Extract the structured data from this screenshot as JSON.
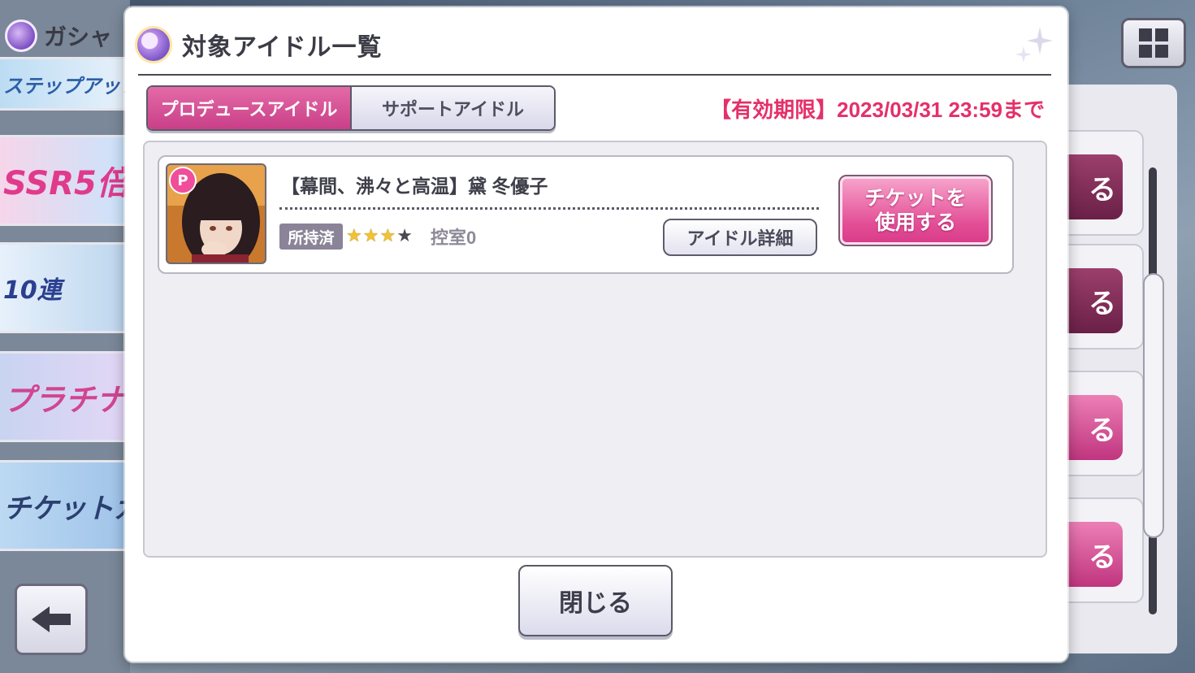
{
  "background": {
    "gacha_title": "ガシャ",
    "banners": [
      {
        "text": "ステップアップガ"
      },
      {
        "text": "SSR5倍"
      },
      {
        "text": "10連"
      },
      {
        "text": "プラチナガ"
      },
      {
        "text": "チケットガ"
      }
    ],
    "right_buttons": [
      "る",
      "る",
      "る",
      "る"
    ]
  },
  "modal": {
    "title": "対象アイドル一覧",
    "tabs": [
      {
        "label": "プロデュースアイドル",
        "active": true
      },
      {
        "label": "サポートアイドル",
        "active": false
      }
    ],
    "expiry_text": "【有効期限】2023/03/31 23:59まで",
    "idols": [
      {
        "name": "【幕間、沸々と高温】黛 冬優子",
        "type_badge": "P",
        "owned_label": "所持済",
        "stars_filled": 3,
        "stars_total": 4,
        "reserve_text": "控室0",
        "detail_button": "アイドル詳細",
        "use_ticket_button": "チケットを\n使用する"
      }
    ],
    "close_button": "閉じる"
  },
  "colors": {
    "accent_pink": "#e34e96",
    "expiry_red": "#e5306a",
    "owned_badge": "#8b8498"
  }
}
